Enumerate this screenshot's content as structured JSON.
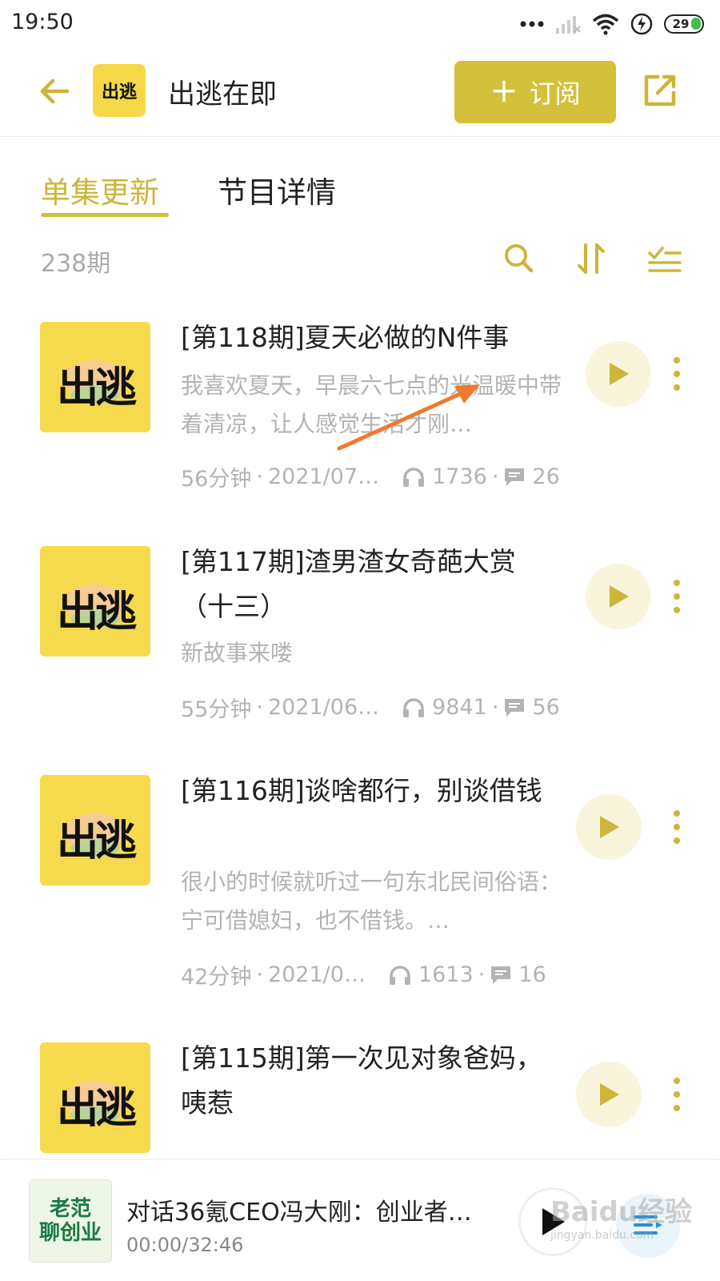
{
  "status_bar": {
    "time": "19:50",
    "battery": "29"
  },
  "header": {
    "title": "出逃在即",
    "logo_text": "出逃",
    "subscribe_label": "订阅"
  },
  "tabs": [
    {
      "label": "单集更新",
      "active": true
    },
    {
      "label": "节目详情",
      "active": false
    }
  ],
  "toolbar": {
    "episode_count": "238期"
  },
  "cover_text": "出逃",
  "episodes": [
    {
      "title": "[第118期]夏天必做的N件事",
      "desc": "我喜欢夏天，早晨六七点的光温暖中带着清凉，让人感觉生活才刚…",
      "duration": "56分钟",
      "date": "2021/07…",
      "plays": "1736",
      "comments": "26"
    },
    {
      "title": "[第117期]渣男渣女奇葩大赏（十三）",
      "desc": "新故事来喽",
      "duration": "55分钟",
      "date": "2021/06…",
      "plays": "9841",
      "comments": "56"
    },
    {
      "title": "[第116期]谈啥都行，别谈借钱",
      "desc": "很小的时候就听过一句东北民间俗语：宁可借媳妇，也不借钱。…",
      "duration": "42分钟",
      "date": "2021/0…",
      "plays": "1613",
      "comments": "16"
    },
    {
      "title": "[第115期]第一次见对象爸妈，咦惹",
      "desc": "",
      "duration": "",
      "date": "",
      "plays": "",
      "comments": ""
    }
  ],
  "player": {
    "cover_line1": "老范",
    "cover_line2": "聊创业",
    "title": "对话36氪CEO冯大刚：创业者…",
    "time": "00:00/32:46"
  },
  "watermark": {
    "text": "Baidu经验",
    "url": "jingyan.baidu.com"
  },
  "colors": {
    "accent": "#d4c03a",
    "cover_bg": "#f7d94e",
    "muted_text": "#b3b3b3",
    "arrow": "#f07a2e"
  }
}
